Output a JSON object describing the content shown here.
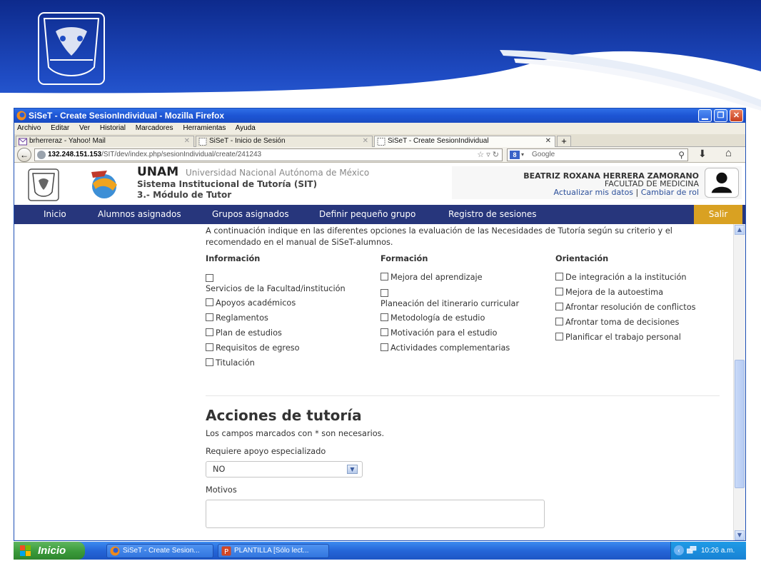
{
  "window": {
    "title": "SiSeT - Create SesionIndividual - Mozilla Firefox",
    "controls": [
      "minimize",
      "maximize",
      "close"
    ]
  },
  "menubar": [
    "Archivo",
    "Editar",
    "Ver",
    "Historial",
    "Marcadores",
    "Herramientas",
    "Ayuda"
  ],
  "tabs": [
    {
      "label": "brherreraz - Yahoo! Mail",
      "icon": "mail-icon"
    },
    {
      "label": "SiSeT - Inicio de Sesión",
      "icon": "page-icon"
    },
    {
      "label": "SiSeT - Create SesionIndividual",
      "icon": "page-icon",
      "active": true
    }
  ],
  "navbar": {
    "url_host": "132.248.151.153",
    "url_path": "/SIT/dev/index.php/sesionIndividual/create/241243",
    "search_placeholder": "Google"
  },
  "site": {
    "name": "UNAM",
    "name_full": "Universidad Nacional Autónoma de México",
    "system": "Sistema Institucional de Tutoría (SIT)",
    "module": "3.- Módulo de Tutor"
  },
  "user": {
    "name": "BEATRIZ ROXANA HERRERA ZAMORANO",
    "faculty": "FACULTAD DE MEDICINA",
    "link_update": "Actualizar mis datos",
    "separator": "|",
    "link_role": "Cambiar de rol"
  },
  "nav": {
    "items": [
      "Inicio",
      "Alumnos asignados",
      "Grupos asignados",
      "Definir pequeño grupo",
      "Registro de sesiones"
    ],
    "logout": "Salir",
    "bar_color": "#27367c",
    "logout_color": "#d9a122"
  },
  "form": {
    "intro": "A continuación indique en las diferentes opciones la evaluación de las Necesidades de Tutoría según su criterio y el recomendado en el manual de SiSeT-alumnos.",
    "columns": [
      {
        "title": "Información",
        "options": [
          "Servicios de la Facultad/institución",
          "Apoyos académicos",
          "Reglamentos",
          "Plan de estudios",
          "Requisitos de egreso",
          "Titulación"
        ]
      },
      {
        "title": "Formación",
        "options": [
          "Mejora del aprendizaje",
          "Planeación del itinerario curricular",
          "Metodología de estudio",
          "Motivación para el estudio",
          "Actividades complementarias"
        ]
      },
      {
        "title": "Orientación",
        "options": [
          "De integración a la institución",
          "Mejora de la autoestima",
          "Afrontar resolución de conflictos",
          "Afrontar toma de decisiones",
          "Planificar el trabajo personal"
        ]
      }
    ],
    "section_title": "Acciones de tutoría",
    "required_note": "Los campos marcados con * son necesarios.",
    "apoyo_label": "Requiere apoyo especializado",
    "apoyo_value": "NO",
    "motivos_label": "Motivos",
    "motivos_value": ""
  },
  "taskbar": {
    "start_label": "Inicio",
    "tasks": [
      {
        "label": "SiSeT - Create Sesion...",
        "icon": "firefox-icon"
      },
      {
        "label": "PLANTILLA [Sólo lect...",
        "icon": "powerpoint-icon"
      }
    ],
    "clock": "10:26 a.m."
  }
}
